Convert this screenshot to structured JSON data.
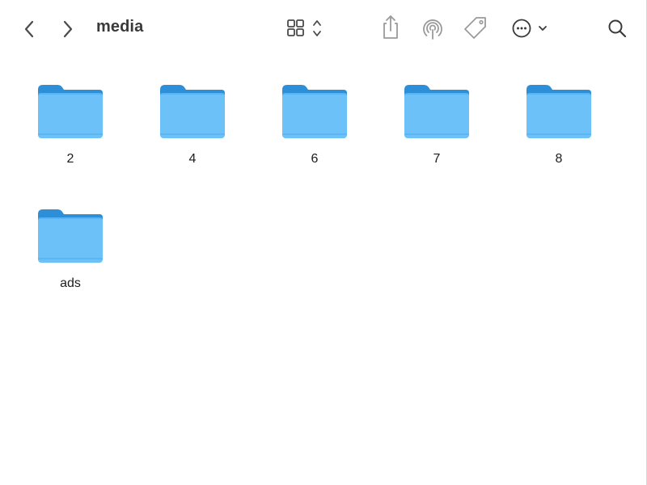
{
  "window": {
    "title": "media"
  },
  "toolbar": {
    "back_icon": "chevron-left-icon",
    "forward_icon": "chevron-right-icon",
    "view_icon": "grid-view-icon",
    "share_icon": "share-icon",
    "airdrop_icon": "airdrop-icon",
    "tag_icon": "tag-icon",
    "more_icon": "ellipsis-circle-icon",
    "search_icon": "search-icon"
  },
  "folders": [
    {
      "name": "2"
    },
    {
      "name": "4"
    },
    {
      "name": "6"
    },
    {
      "name": "7"
    },
    {
      "name": "8"
    },
    {
      "name": "ads"
    }
  ],
  "colors": {
    "folder_front": "#6cc1f8",
    "folder_back": "#2d8fd7",
    "icon_gray": "#8e8e8e",
    "icon_dark": "#3a3a3a"
  }
}
